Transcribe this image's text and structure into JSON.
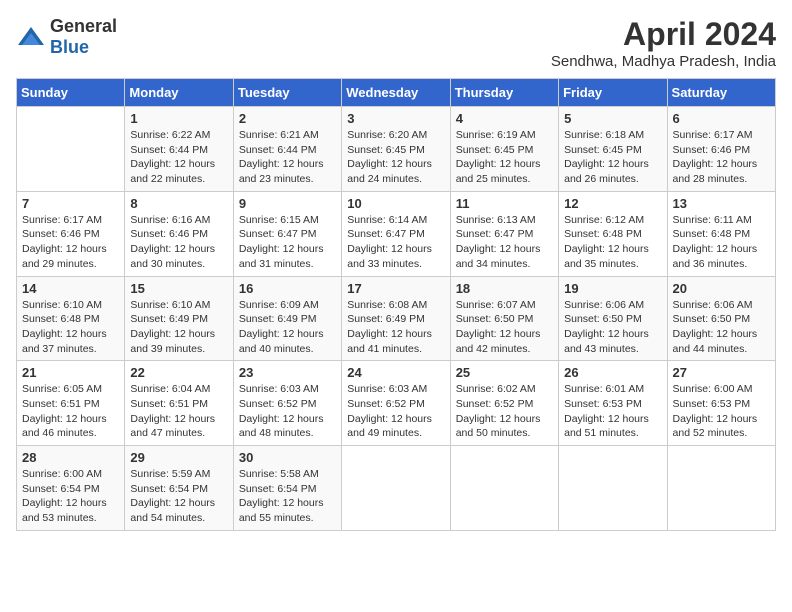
{
  "logo": {
    "general": "General",
    "blue": "Blue"
  },
  "title": "April 2024",
  "subtitle": "Sendhwa, Madhya Pradesh, India",
  "days_of_week": [
    "Sunday",
    "Monday",
    "Tuesday",
    "Wednesday",
    "Thursday",
    "Friday",
    "Saturday"
  ],
  "weeks": [
    [
      {
        "day": "",
        "info": ""
      },
      {
        "day": "1",
        "info": "Sunrise: 6:22 AM\nSunset: 6:44 PM\nDaylight: 12 hours\nand 22 minutes."
      },
      {
        "day": "2",
        "info": "Sunrise: 6:21 AM\nSunset: 6:44 PM\nDaylight: 12 hours\nand 23 minutes."
      },
      {
        "day": "3",
        "info": "Sunrise: 6:20 AM\nSunset: 6:45 PM\nDaylight: 12 hours\nand 24 minutes."
      },
      {
        "day": "4",
        "info": "Sunrise: 6:19 AM\nSunset: 6:45 PM\nDaylight: 12 hours\nand 25 minutes."
      },
      {
        "day": "5",
        "info": "Sunrise: 6:18 AM\nSunset: 6:45 PM\nDaylight: 12 hours\nand 26 minutes."
      },
      {
        "day": "6",
        "info": "Sunrise: 6:17 AM\nSunset: 6:46 PM\nDaylight: 12 hours\nand 28 minutes."
      }
    ],
    [
      {
        "day": "7",
        "info": "Sunrise: 6:17 AM\nSunset: 6:46 PM\nDaylight: 12 hours\nand 29 minutes."
      },
      {
        "day": "8",
        "info": "Sunrise: 6:16 AM\nSunset: 6:46 PM\nDaylight: 12 hours\nand 30 minutes."
      },
      {
        "day": "9",
        "info": "Sunrise: 6:15 AM\nSunset: 6:47 PM\nDaylight: 12 hours\nand 31 minutes."
      },
      {
        "day": "10",
        "info": "Sunrise: 6:14 AM\nSunset: 6:47 PM\nDaylight: 12 hours\nand 33 minutes."
      },
      {
        "day": "11",
        "info": "Sunrise: 6:13 AM\nSunset: 6:47 PM\nDaylight: 12 hours\nand 34 minutes."
      },
      {
        "day": "12",
        "info": "Sunrise: 6:12 AM\nSunset: 6:48 PM\nDaylight: 12 hours\nand 35 minutes."
      },
      {
        "day": "13",
        "info": "Sunrise: 6:11 AM\nSunset: 6:48 PM\nDaylight: 12 hours\nand 36 minutes."
      }
    ],
    [
      {
        "day": "14",
        "info": "Sunrise: 6:10 AM\nSunset: 6:48 PM\nDaylight: 12 hours\nand 37 minutes."
      },
      {
        "day": "15",
        "info": "Sunrise: 6:10 AM\nSunset: 6:49 PM\nDaylight: 12 hours\nand 39 minutes."
      },
      {
        "day": "16",
        "info": "Sunrise: 6:09 AM\nSunset: 6:49 PM\nDaylight: 12 hours\nand 40 minutes."
      },
      {
        "day": "17",
        "info": "Sunrise: 6:08 AM\nSunset: 6:49 PM\nDaylight: 12 hours\nand 41 minutes."
      },
      {
        "day": "18",
        "info": "Sunrise: 6:07 AM\nSunset: 6:50 PM\nDaylight: 12 hours\nand 42 minutes."
      },
      {
        "day": "19",
        "info": "Sunrise: 6:06 AM\nSunset: 6:50 PM\nDaylight: 12 hours\nand 43 minutes."
      },
      {
        "day": "20",
        "info": "Sunrise: 6:06 AM\nSunset: 6:50 PM\nDaylight: 12 hours\nand 44 minutes."
      }
    ],
    [
      {
        "day": "21",
        "info": "Sunrise: 6:05 AM\nSunset: 6:51 PM\nDaylight: 12 hours\nand 46 minutes."
      },
      {
        "day": "22",
        "info": "Sunrise: 6:04 AM\nSunset: 6:51 PM\nDaylight: 12 hours\nand 47 minutes."
      },
      {
        "day": "23",
        "info": "Sunrise: 6:03 AM\nSunset: 6:52 PM\nDaylight: 12 hours\nand 48 minutes."
      },
      {
        "day": "24",
        "info": "Sunrise: 6:03 AM\nSunset: 6:52 PM\nDaylight: 12 hours\nand 49 minutes."
      },
      {
        "day": "25",
        "info": "Sunrise: 6:02 AM\nSunset: 6:52 PM\nDaylight: 12 hours\nand 50 minutes."
      },
      {
        "day": "26",
        "info": "Sunrise: 6:01 AM\nSunset: 6:53 PM\nDaylight: 12 hours\nand 51 minutes."
      },
      {
        "day": "27",
        "info": "Sunrise: 6:00 AM\nSunset: 6:53 PM\nDaylight: 12 hours\nand 52 minutes."
      }
    ],
    [
      {
        "day": "28",
        "info": "Sunrise: 6:00 AM\nSunset: 6:54 PM\nDaylight: 12 hours\nand 53 minutes."
      },
      {
        "day": "29",
        "info": "Sunrise: 5:59 AM\nSunset: 6:54 PM\nDaylight: 12 hours\nand 54 minutes."
      },
      {
        "day": "30",
        "info": "Sunrise: 5:58 AM\nSunset: 6:54 PM\nDaylight: 12 hours\nand 55 minutes."
      },
      {
        "day": "",
        "info": ""
      },
      {
        "day": "",
        "info": ""
      },
      {
        "day": "",
        "info": ""
      },
      {
        "day": "",
        "info": ""
      }
    ]
  ]
}
